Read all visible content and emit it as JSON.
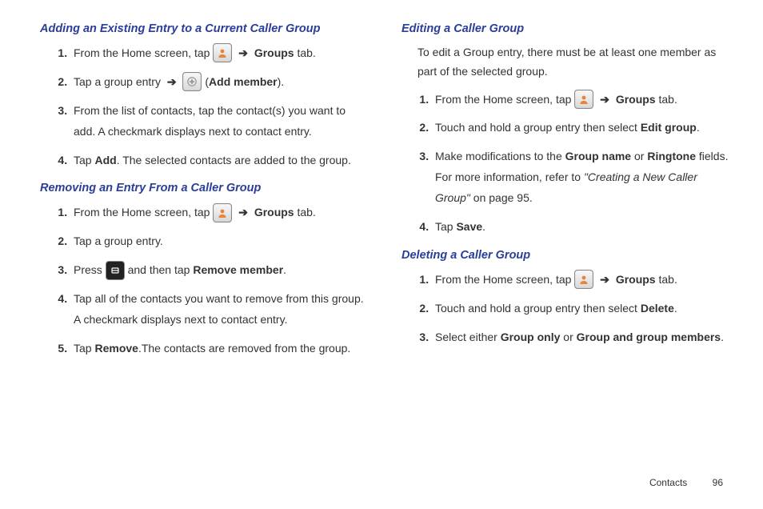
{
  "col1": {
    "sectionA": {
      "heading": "Adding an Existing Entry to a Current Caller Group",
      "items": [
        {
          "pre": "From the Home screen, tap ",
          "icon": "contact",
          "arrow": "➔",
          "bold": "Groups",
          "post": " tab."
        },
        {
          "pre": "Tap a group entry ",
          "arrow2": "➔",
          "icon": "plus",
          "openParen": " (",
          "bold": "Add member",
          "closeParen": ")."
        },
        {
          "text": "From the list of contacts, tap the contact(s) you want to add. A checkmark displays next to contact entry."
        },
        {
          "pre": "Tap ",
          "bold": "Add",
          "post": ". The selected contacts are added to the group."
        }
      ]
    },
    "sectionB": {
      "heading": "Removing an Entry From a Caller Group",
      "items": [
        {
          "pre": "From the Home screen, tap ",
          "icon": "contact",
          "arrow": "➔",
          "bold": "Groups",
          "post": " tab."
        },
        {
          "text": "Tap a group entry."
        },
        {
          "pre": "Press ",
          "icon": "menu",
          "mid": " and then tap ",
          "bold": "Remove member",
          "post": "."
        },
        {
          "text": "Tap all of the contacts you want to remove from this group. A checkmark displays next to contact entry."
        },
        {
          "pre": "Tap ",
          "bold": "Remove",
          "post": ".The contacts are removed from the group."
        }
      ]
    }
  },
  "col2": {
    "sectionC": {
      "heading": "Editing a Caller Group",
      "intro": "To edit a Group entry, there must be at least one member as part of the selected group.",
      "items": [
        {
          "pre": "From the Home screen, tap ",
          "icon": "contact",
          "arrow": "➔",
          "bold": "Groups",
          "post": " tab."
        },
        {
          "pre": "Touch and hold a group entry then select ",
          "bold": "Edit group",
          "post": "."
        },
        {
          "pre": "Make modifications to the ",
          "bold": "Group name",
          "mid": " or ",
          "bold2": "Ringtone",
          "post2": " fields. For more information, refer to ",
          "ital": "\"Creating a New Caller Group\"",
          "post3": "  on page 95."
        },
        {
          "pre": "Tap ",
          "bold": "Save",
          "post": "."
        }
      ]
    },
    "sectionD": {
      "heading": "Deleting a Caller Group",
      "items": [
        {
          "pre": "From the Home screen, tap ",
          "icon": "contact",
          "arrow": "➔",
          "bold": "Groups",
          "post": " tab."
        },
        {
          "pre": "Touch and hold a group entry then select ",
          "bold": "Delete",
          "post": "."
        },
        {
          "pre": "Select either ",
          "bold": "Group only",
          "mid": " or ",
          "bold2": "Group and group members",
          "post2": "."
        }
      ]
    }
  },
  "footer": {
    "section": "Contacts",
    "page": "96"
  }
}
